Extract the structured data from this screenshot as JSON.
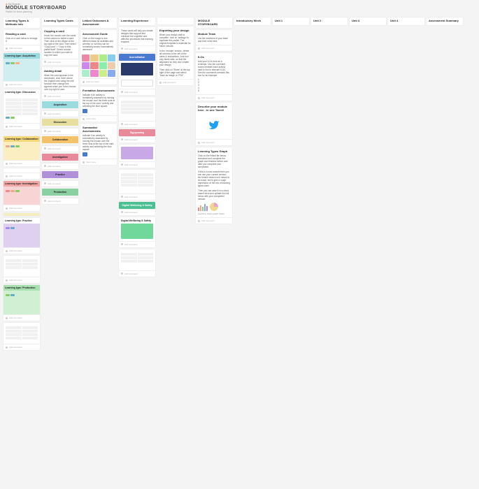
{
  "header": {
    "crumb_home": "My Boards",
    "crumb_sep": "  ›  ",
    "title": "MODULE STORYBOARD",
    "subtitle": "Padlet for team planning"
  },
  "columns": [
    {
      "title": "Learning Types & Methods Info"
    },
    {
      "title": "Learning Types Cards"
    },
    {
      "title": "Linked Outcomes & Assessment"
    },
    {
      "title": "Learning Experience"
    },
    {
      "title": ""
    },
    {
      "title": "MODULE STORYBOARD"
    },
    {
      "title": "Introductory Week"
    },
    {
      "title": "Unit 1"
    },
    {
      "title": "Unit 2"
    },
    {
      "title": "Unit 3"
    },
    {
      "title": "Unit 4"
    },
    {
      "title": "Assessment Summary"
    }
  ],
  "col0": {
    "reading": {
      "title": "Reading a card",
      "text": "Click on a card below to enlarge it"
    },
    "acq": {
      "label": "Learning type: Acquisition",
      "color": "#9adbe0"
    },
    "disc": {
      "label": "Learning type: Discussion",
      "color": "#fff"
    },
    "collab": {
      "label": "Learning type: Collaboration",
      "color": "#f5d87a"
    },
    "inv": {
      "label": "Learning type: Investigation",
      "color": "#f2a6a6"
    },
    "prac": {
      "label": "Learning type: Practice",
      "color": "#caa8e8"
    },
    "prod": {
      "label": "Learning type: Production",
      "color": "#a8e0b0"
    }
  },
  "col1": {
    "copy": {
      "title": "Copying a card",
      "text": "Hover the mouse over the cards in this column to select a card. Then click on the ellipse at the top right of the card. Then select \"Copy post\" > \"Copy to this padlet itself\" Select column location to which you wish to copy the card."
    },
    "detail": {
      "title": "Adding detail",
      "text": "When the card appears in the storyboard, click more above the original card using the edit function then change this appears when you hover mouse over top right of card."
    },
    "bands": {
      "acq": "Acquisition",
      "disc": "Discussion",
      "collab": "Collaboration",
      "inv": "Investigation",
      "prac": "Practice",
      "prod": "Production"
    }
  },
  "col2": {
    "guide": {
      "title": "Assessment Guide",
      "text": "Click on the image to see different ideas for activities and whether or not they can be formatively and/or summatively assessed."
    },
    "formative": {
      "title": "Formative Assessments",
      "text": "Indicate if an activity is formatively assessed by moving the mouse over the three dots at the top of the card / activity and selecting the blue square"
    },
    "summative": {
      "title": "Summative Assessments",
      "text": "Indicate if an activity is summatively assessed by moving the mouse over the three dots at the top of the card activity and selecting the blue square"
    }
  },
  "col3": {
    "intro": {
      "text": "These cards will help you create designs that support and enhance the cognitive and affective processes that learning requires."
    },
    "accred": "Accreditation",
    "signpost": "Signposting",
    "wellbeing": "Digital Wellbeing & Safety",
    "wellbeing2": "Digital Wellbeing & Safety"
  },
  "col4": {
    "export": {
      "title": "Exporting your design",
      "text": "When your design draft is complete, click on 'settings' to duplicate this padlet. The original template is essential for future cohorts."
    },
    "export2": "In the 'remake' version, delete all columns to the left of the cards & instructions. Just trim only blank cells, so that the alignment so they don't clutter your design.",
    "export3": "Then click on 'Share' at the top right of the page and select 'Save as image' or 'PDF'."
  },
  "col5": {
    "team": {
      "title": "Module Team",
      "text": "List the members of your team and their roles here."
    },
    "ilos": {
      "title": "ILOs",
      "text": "Add your ILOs here as a reminder. Use the comment boxes beneath each activity card to link to relevant ILOs. See the comments beneath this box for an example.",
      "nums": "1\n2\n3\n4\n5"
    },
    "tweet": {
      "title": "Describe your module here - in one Tweet!"
    },
    "graph": {
      "title": "Learning Types Graph",
      "text": "Click on the linked file below, download and complete the graph and timeline before and after you complete your storyboard",
      "text2": "If this is a new module then you can use your current version, the before version isn't meant to be exact, but to give a rough impression of the mix of learning types used.",
      "text3": "Then you can save it in a cloud based drive and update the link below with your completed version."
    }
  },
  "foot": {
    "add": "Add comment",
    "more": "View more"
  },
  "colors": {
    "acq": "#9adbe0",
    "disc": "#e8d480",
    "collab": "#f5c26b",
    "inv": "#e88a9a",
    "prac": "#b090d8",
    "prod": "#8ad0a0",
    "blue": "#4a7ad0",
    "green_band": "#4ac090",
    "purple_band": "#c0a0e0"
  }
}
